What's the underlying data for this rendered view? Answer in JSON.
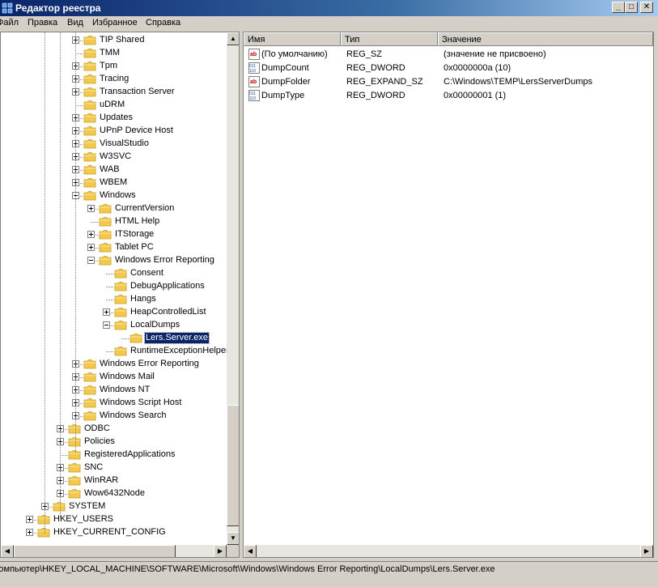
{
  "window": {
    "title": "Редактор реестра",
    "buttons": {
      "minimize": "_",
      "maximize": "□",
      "close": "✕"
    }
  },
  "menu": [
    "Файл",
    "Правка",
    "Вид",
    "Избранное",
    "Справка"
  ],
  "tree": [
    {
      "label": "TIP Shared",
      "indent": 3,
      "expander": "plus"
    },
    {
      "label": "TMM",
      "indent": 3,
      "expander": "none"
    },
    {
      "label": "Tpm",
      "indent": 3,
      "expander": "plus"
    },
    {
      "label": "Tracing",
      "indent": 3,
      "expander": "plus"
    },
    {
      "label": "Transaction Server",
      "indent": 3,
      "expander": "plus"
    },
    {
      "label": "uDRM",
      "indent": 3,
      "expander": "none"
    },
    {
      "label": "Updates",
      "indent": 3,
      "expander": "plus"
    },
    {
      "label": "UPnP Device Host",
      "indent": 3,
      "expander": "plus"
    },
    {
      "label": "VisualStudio",
      "indent": 3,
      "expander": "plus"
    },
    {
      "label": "W3SVC",
      "indent": 3,
      "expander": "plus"
    },
    {
      "label": "WAB",
      "indent": 3,
      "expander": "plus"
    },
    {
      "label": "WBEM",
      "indent": 3,
      "expander": "plus"
    },
    {
      "label": "Windows",
      "indent": 3,
      "expander": "minus"
    },
    {
      "label": "CurrentVersion",
      "indent": 4,
      "expander": "plus"
    },
    {
      "label": "HTML Help",
      "indent": 4,
      "expander": "none"
    },
    {
      "label": "ITStorage",
      "indent": 4,
      "expander": "plus"
    },
    {
      "label": "Tablet PC",
      "indent": 4,
      "expander": "plus"
    },
    {
      "label": "Windows Error Reporting",
      "indent": 4,
      "expander": "minus"
    },
    {
      "label": "Consent",
      "indent": 5,
      "expander": "none"
    },
    {
      "label": "DebugApplications",
      "indent": 5,
      "expander": "none"
    },
    {
      "label": "Hangs",
      "indent": 5,
      "expander": "none"
    },
    {
      "label": "HeapControlledList",
      "indent": 5,
      "expander": "plus"
    },
    {
      "label": "LocalDumps",
      "indent": 5,
      "expander": "minus"
    },
    {
      "label": "Lers.Server.exe",
      "indent": 6,
      "expander": "none",
      "selected": true
    },
    {
      "label": "RuntimeExceptionHelperModules",
      "indent": 5,
      "expander": "none"
    },
    {
      "label": "Windows Error Reporting",
      "indent": 3,
      "expander": "plus"
    },
    {
      "label": "Windows Mail",
      "indent": 3,
      "expander": "plus"
    },
    {
      "label": "Windows NT",
      "indent": 3,
      "expander": "plus"
    },
    {
      "label": "Windows Script Host",
      "indent": 3,
      "expander": "plus"
    },
    {
      "label": "Windows Search",
      "indent": 3,
      "expander": "plus"
    },
    {
      "label": "ODBC",
      "indent": 2,
      "expander": "plus"
    },
    {
      "label": "Policies",
      "indent": 2,
      "expander": "plus"
    },
    {
      "label": "RegisteredApplications",
      "indent": 2,
      "expander": "none"
    },
    {
      "label": "SNC",
      "indent": 2,
      "expander": "plus"
    },
    {
      "label": "WinRAR",
      "indent": 2,
      "expander": "plus"
    },
    {
      "label": "Wow6432Node",
      "indent": 2,
      "expander": "plus"
    },
    {
      "label": "SYSTEM",
      "indent": 1,
      "expander": "plus"
    },
    {
      "label": "HKEY_USERS",
      "indent": 0,
      "expander": "plus"
    },
    {
      "label": "HKEY_CURRENT_CONFIG",
      "indent": 0,
      "expander": "plus"
    }
  ],
  "list": {
    "headers": [
      "Имя",
      "Тип",
      "Значение"
    ],
    "rows": [
      {
        "icon": "string-value-icon",
        "name": "(По умолчанию)",
        "type": "REG_SZ",
        "value": "(значение не присвоено)"
      },
      {
        "icon": "binary-value-icon",
        "name": "DumpCount",
        "type": "REG_DWORD",
        "value": "0x0000000a (10)"
      },
      {
        "icon": "string-value-icon",
        "name": "DumpFolder",
        "type": "REG_EXPAND_SZ",
        "value": "C:\\Windows\\TEMP\\LersServerDumps"
      },
      {
        "icon": "binary-value-icon",
        "name": "DumpType",
        "type": "REG_DWORD",
        "value": "0x00000001 (1)"
      }
    ]
  },
  "status": "Компьютер\\HKEY_LOCAL_MACHINE\\SOFTWARE\\Microsoft\\Windows\\Windows Error Reporting\\LocalDumps\\Lers.Server.exe",
  "colors": {
    "selection": "#0a246a",
    "folder": "#f2c94c",
    "titlebar": "#0a246a"
  }
}
